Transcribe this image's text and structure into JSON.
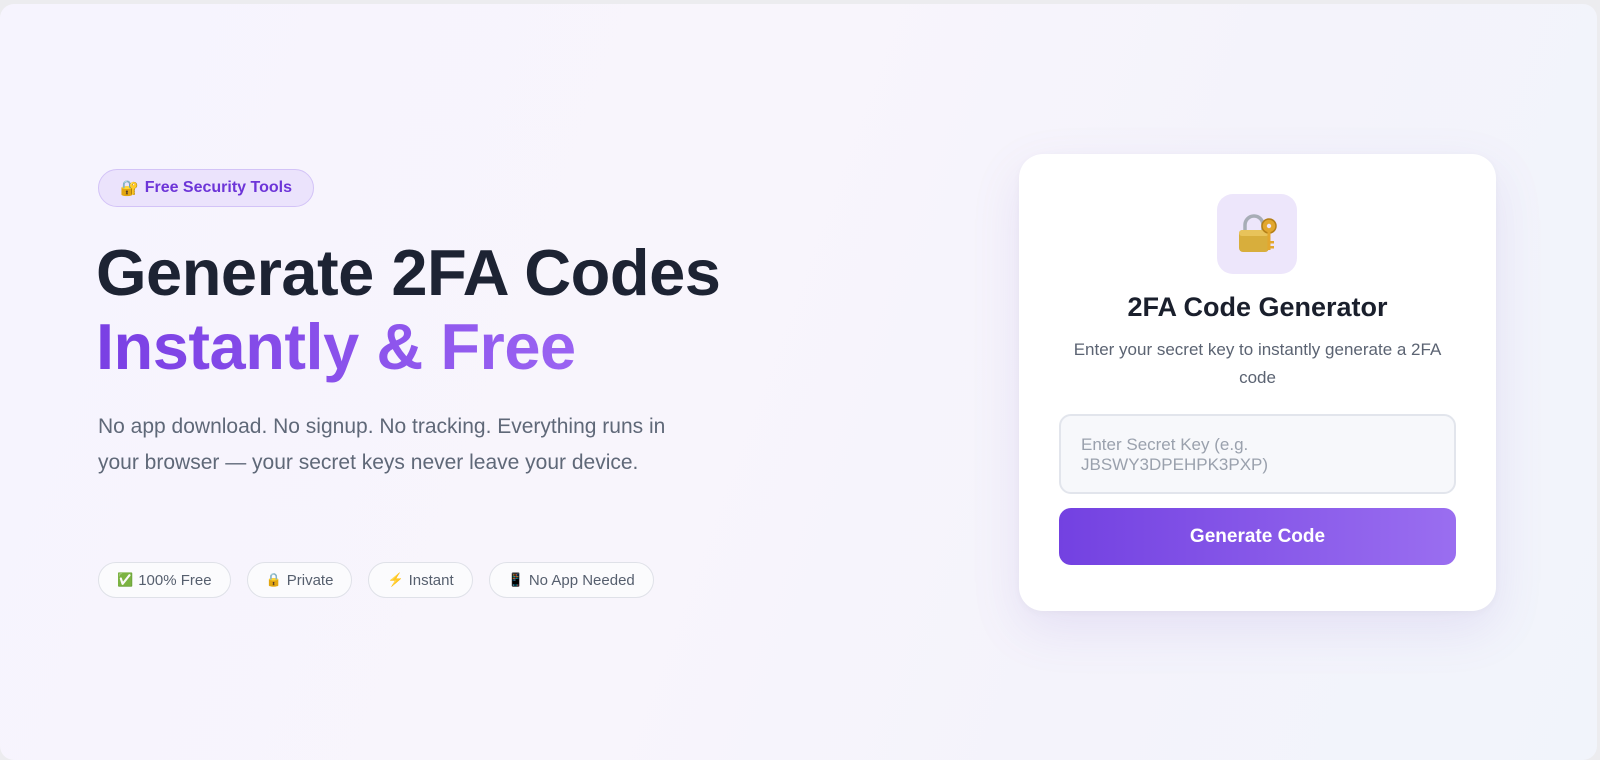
{
  "hero": {
    "badge": {
      "icon": "lock-with-key-icon",
      "glyph": "🔐",
      "label": "Free Security Tools"
    },
    "headline_line1": "Generate 2FA Codes",
    "headline_line2": "Instantly & Free",
    "lead": "No app download. No signup. No tracking. Everything runs in your browser — your secret keys never leave your device.",
    "features": [
      {
        "icon": "checkmark-icon",
        "glyph": "✅",
        "label": "100% Free"
      },
      {
        "icon": "lock-icon",
        "glyph": "🔒",
        "label": "Private"
      },
      {
        "icon": "lightning-icon",
        "glyph": "⚡",
        "label": "Instant"
      },
      {
        "icon": "mobile-phone-icon",
        "glyph": "📱",
        "label": "No App Needed"
      }
    ]
  },
  "card": {
    "icon": "lock-with-key-icon",
    "title": "2FA Code Generator",
    "subtitle": "Enter your secret key to instantly generate a 2FA code",
    "input_value": "",
    "input_placeholder": "Enter Secret Key (e.g. JBSWY3DPEHPK3PXP)",
    "button_label": "Generate Code"
  },
  "colors": {
    "accent": "#7c3aed",
    "accent_light": "#9a6ef0",
    "heading": "#1d2333",
    "muted_text": "#5f6878"
  }
}
